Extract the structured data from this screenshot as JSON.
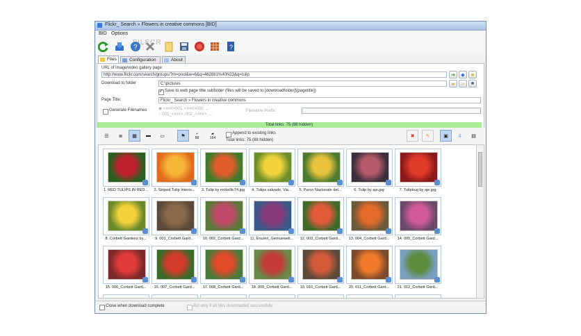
{
  "window": {
    "title": "Flickr_ Search » Flowers in creative commons [BID]",
    "watermark": "FILECR"
  },
  "menu": [
    "BID",
    "Options"
  ],
  "toolbar_icons": [
    "refresh-icon",
    "download-icon",
    "help-icon",
    "stop-icon",
    "clipboard-icon",
    "save-icon",
    "record-icon",
    "grid-icon",
    "info-icon"
  ],
  "tabs": [
    "Files",
    "Configuration",
    "About"
  ],
  "form": {
    "url_label": "URL of image/video gallery page:",
    "url_value": "http://www.flickr.com/search/groups/?m=pool&w=6&q=462881%40N23&q=tulip",
    "folder_label": "Download to folder",
    "folder_value": "C:\\pictures",
    "subfolder_label": "Save to web page title subfolder (files will be saved to [downloadfolder]\\[pagetitle])",
    "page_title_label": "Page Title:",
    "page_title_value": "Flickr_ Search » Flowers in creative commons",
    "generate_label": "Generate Filenames",
    "radio1": "<###>001, <###>002, ...",
    "radio2": "001_<###>, 002_<###>, ...",
    "prefix_label": "Filename Prefix:"
  },
  "status": "Total links: 75 (88 hidden)",
  "view_tools": {
    "append_label": "Append to existing links",
    "total_label": "Total links: 75 (88 hidden)",
    "count_a": "88",
    "count_b": "164"
  },
  "thumbnails": [
    "1. RED TULIPS IN RED...",
    "2. Striped Tulip Interio...",
    "3. Tulip by mckellic74.jpg",
    "4. Tulips salvado, Via...",
    "5. Parco Nazionale del...",
    "6. Tulip by aje.jpg",
    "7. Tulipbug by aje.jpg",
    "8. Corbett Gardens by...",
    "9. 001_Corbett Gard...",
    "10. 002_Corbett Gard...",
    "11. Eruzen_Gemuewell...",
    "12. 003_Corbett Gard...",
    "13. 004_Corbett Gard...",
    "14. 005_Corbett Gard...",
    "15. 006_Corbett Gard...",
    "16. 007_Corbett Gard...",
    "17. 008_Corbett Gard...",
    "18. 009_Corbett Gard...",
    "19. 010_Corbett Gard...",
    "20. 011_Corbett Gard...",
    "21. 012_Corbett Gard..."
  ],
  "bottom": {
    "close_label": "Close when download complete",
    "only_label": "But only if all files downloaded successfully"
  },
  "colors": {
    "status_bar": "#a9ec95",
    "selected_view": "#bcd6f4"
  }
}
